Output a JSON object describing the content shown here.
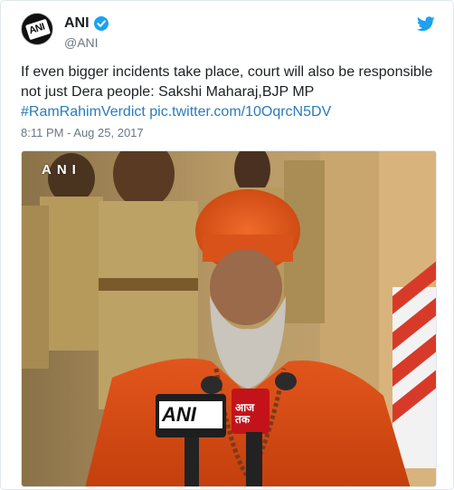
{
  "tweet": {
    "author_name": "ANI",
    "author_handle": "@ANI",
    "avatar_text": "ANI",
    "text_before_link": "If even bigger incidents take place, court will also be responsible not just Dera people: Sakshi Maharaj,BJP MP",
    "hashtag": "#RamRahimVerdict",
    "media_link": "pic.twitter.com/10OqrcN5DV",
    "timestamp": "8:11 PM - Aug 25, 2017"
  },
  "media": {
    "watermark": "ANI",
    "mic_left_label": "ANI",
    "mic_right_label": "आज तक"
  },
  "icons": {
    "verified": "verified-badge-icon",
    "bird": "twitter-bird-icon"
  },
  "colors": {
    "link": "#2b7bb9",
    "verified": "#1da1f2",
    "muted": "#697882"
  }
}
